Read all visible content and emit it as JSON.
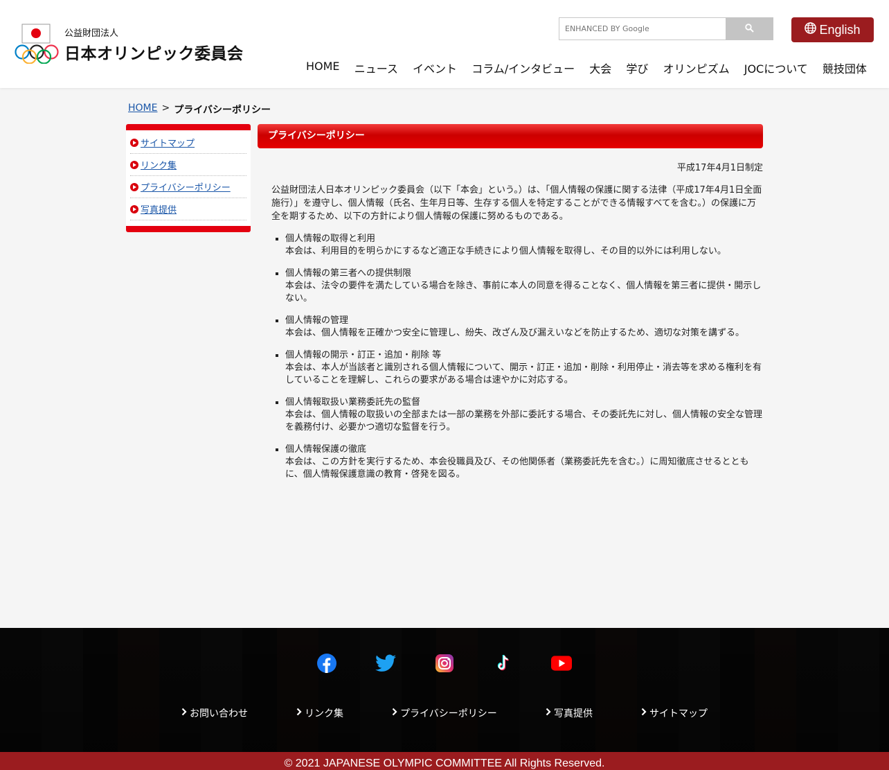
{
  "header": {
    "logo_sub": "公益財団法人",
    "logo_main": "日本オリンピック委員会",
    "search_placeholder": "ENHANCED BY Google",
    "english_label": "English",
    "nav": [
      "HOME",
      "ニュース",
      "イベント",
      "コラム/インタビュー",
      "大会",
      "学び",
      "オリンピズム",
      "JOCについて",
      "競技団体"
    ]
  },
  "breadcrumb": {
    "home": "HOME",
    "separator": ">",
    "current": "プライバシーポリシー"
  },
  "sidebar": {
    "items": [
      {
        "label": "サイトマップ"
      },
      {
        "label": "リンク集"
      },
      {
        "label": "プライバシーポリシー"
      },
      {
        "label": "写真提供"
      }
    ]
  },
  "main": {
    "title": "プライバシーポリシー",
    "date": "平成17年4月1日制定",
    "intro": "公益財団法人日本オリンピック委員会（以下「本会」という。）は、「個人情報の保護に関する法律（平成17年4月1日全面施行）」を遵守し、個人情報（氏名、生年月日等、生存する個人を特定することができる情報すべてを含む。）の保護に万全を期するため、以下の方針により個人情報の保護に努めるものである。",
    "items": [
      {
        "heading": "個人情報の取得と利用",
        "body": "本会は、利用目的を明らかにするなど適正な手続きにより個人情報を取得し、その目的以外には利用しない。"
      },
      {
        "heading": "個人情報の第三者への提供制限",
        "body": "本会は、法令の要件を満たしている場合を除き、事前に本人の同意を得ることなく、個人情報を第三者に提供・開示しない。"
      },
      {
        "heading": "個人情報の管理",
        "body": "本会は、個人情報を正確かつ安全に管理し、紛失、改ざん及び漏えいなどを防止するため、適切な対策を講ずる。"
      },
      {
        "heading": "個人情報の開示・訂正・追加・削除 等",
        "body": "本会は、本人が当該者と識別される個人情報について、開示・訂正・追加・削除・利用停止・消去等を求める権利を有していることを理解し、これらの要求がある場合は速やかに対応する。"
      },
      {
        "heading": "個人情報取扱い業務委託先の監督",
        "body": "本会は、個人情報の取扱いの全部または一部の業務を外部に委託する場合、その委託先に対し、個人情報の安全な管理を義務付け、必要かつ適切な監督を行う。"
      },
      {
        "heading": "個人情報保護の徹底",
        "body": "本会は、この方針を実行するため、本会役職員及び、その他関係者（業務委託先を含む。）に周知徹底させるとともに、個人情報保護意識の教育・啓発を図る。"
      }
    ]
  },
  "footer": {
    "social": [
      "facebook-icon",
      "twitter-icon",
      "instagram-icon",
      "tiktok-icon",
      "youtube-icon"
    ],
    "links": [
      {
        "label": "お問い合わせ"
      },
      {
        "label": "リンク集"
      },
      {
        "label": "プライバシーポリシー"
      },
      {
        "label": "写真提供"
      },
      {
        "label": "サイトマップ"
      }
    ],
    "copyright": "© 2021 JAPANESE OLYMPIC COMMITTEE All Rights Reserved."
  },
  "colors": {
    "accent_red": "#e4000f",
    "dark_red": "#9b1c1f",
    "link_blue": "#1a56a8"
  }
}
